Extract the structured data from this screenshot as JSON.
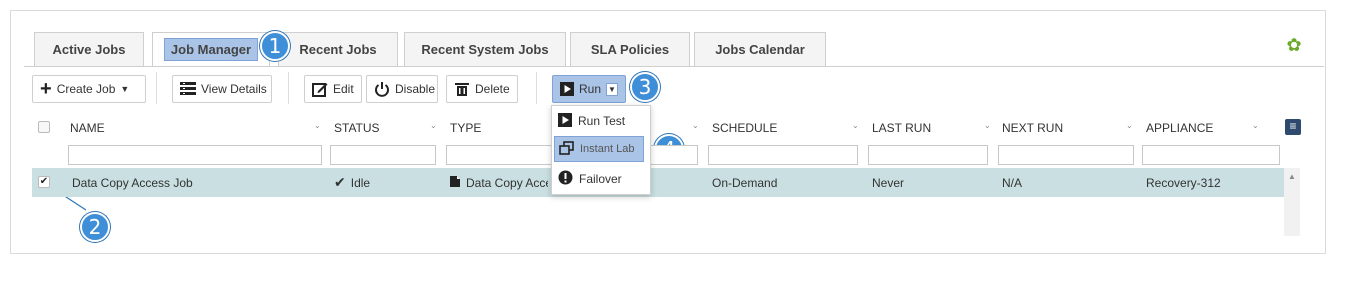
{
  "tabs": [
    {
      "label": "Active Jobs"
    },
    {
      "label": "Job Manager",
      "active": true
    },
    {
      "label": "Recent Jobs"
    },
    {
      "label": "Recent System Jobs"
    },
    {
      "label": "SLA Policies"
    },
    {
      "label": "Jobs Calendar"
    }
  ],
  "toolbar": {
    "create_job": "Create Job",
    "view_details": "View Details",
    "edit": "Edit",
    "disable": "Disable",
    "delete": "Delete",
    "run": "Run"
  },
  "run_menu": {
    "items": [
      {
        "label": "Run Test",
        "icon": "play-icon"
      },
      {
        "label": "Instant Lab",
        "icon": "restore-windows-icon",
        "highlighted": true
      },
      {
        "label": "Failover",
        "icon": "alert-circle-icon"
      }
    ]
  },
  "columns": [
    {
      "label": "NAME"
    },
    {
      "label": "STATUS"
    },
    {
      "label": "TYPE"
    },
    {
      "label": "SCHEDULE"
    },
    {
      "label": "LAST RUN"
    },
    {
      "label": "NEXT RUN"
    },
    {
      "label": "APPLIANCE"
    }
  ],
  "rows": [
    {
      "selected": true,
      "name": "Data Copy Access Job",
      "status": "Idle",
      "type": "Data Copy Acces",
      "schedule": "On-Demand",
      "last_run": "Never",
      "next_run": "N/A",
      "appliance": "Recovery-312"
    }
  ],
  "callouts": [
    "1",
    "2",
    "3",
    "4"
  ],
  "colors": {
    "accent": "#aac4e8",
    "selected_row": "#c9dfe1",
    "callout": "#3f8fd8",
    "gear": "#6aaa2c"
  }
}
